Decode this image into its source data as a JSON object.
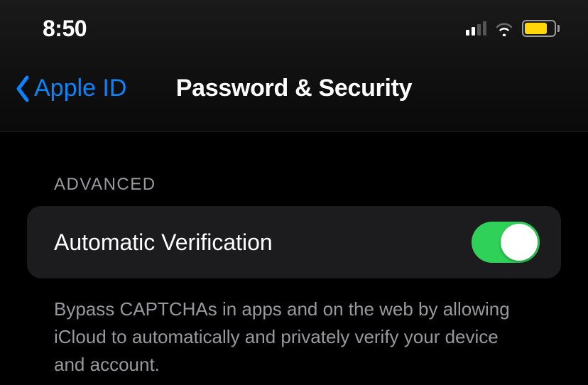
{
  "statusBar": {
    "time": "8:50"
  },
  "nav": {
    "backLabel": "Apple ID",
    "title": "Password & Security"
  },
  "section": {
    "header": "ADVANCED",
    "cell": {
      "label": "Automatic Verification",
      "toggleOn": true
    },
    "footer": "Bypass CAPTCHAs in apps and on the web by allowing iCloud to automatically and privately verify your device and account."
  }
}
